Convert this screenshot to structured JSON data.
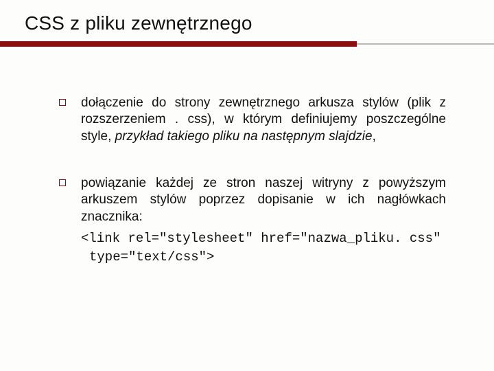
{
  "title": "CSS z pliku zewnętrznego",
  "items": [
    {
      "prefix": "dołączenie do strony zewnętrznego arkusza stylów (plik z rozszerzeniem . css), w którym definiujemy poszczególne style, ",
      "italic": "przykład takiego pliku na następnym slajdzie",
      "suffix": ",",
      "code": ""
    },
    {
      "prefix": "powiązanie każdej ze stron naszej witryny z powyższym arkuszem stylów poprzez dopisanie w ich nagłówkach znacznika:",
      "italic": "",
      "suffix": "",
      "code_line1": "<link rel=\"stylesheet\" href=\"nazwa_pliku. css\"",
      "code_line2": "type=\"text/css\">"
    }
  ]
}
